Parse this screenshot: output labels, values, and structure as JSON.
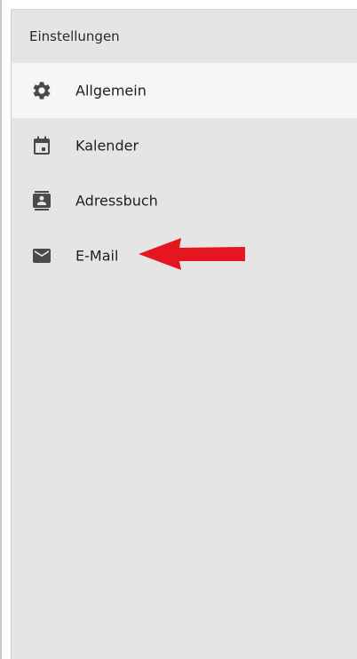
{
  "settings_panel": {
    "title": "Einstellungen",
    "items": [
      {
        "label": "Allgemein",
        "icon": "gear-icon",
        "active": true
      },
      {
        "label": "Kalender",
        "icon": "calendar-icon",
        "active": false
      },
      {
        "label": "Adressbuch",
        "icon": "address-book-icon",
        "active": false
      },
      {
        "label": "E-Mail",
        "icon": "envelope-icon",
        "active": false
      }
    ]
  },
  "annotation": {
    "arrow_color": "#e5161f",
    "icon_color": "#4a4a4a",
    "accent_bg_active": "#f6f6f6",
    "panel_bg": "#e5e5e5"
  }
}
